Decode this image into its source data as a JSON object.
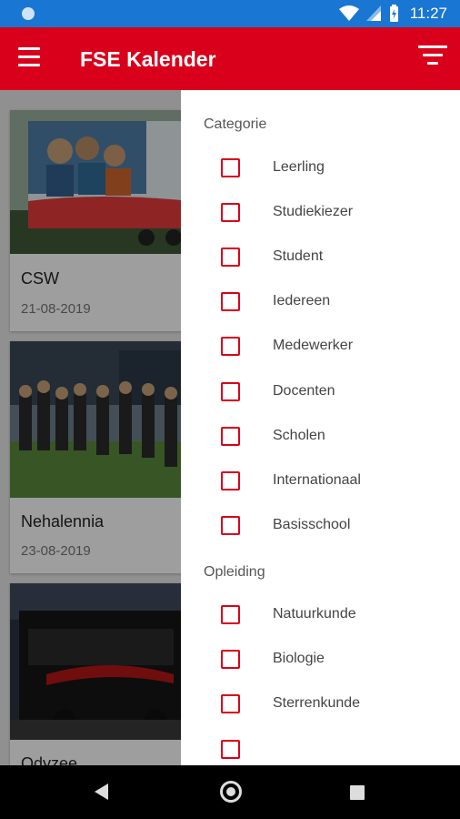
{
  "status_bar": {
    "time": "11:27",
    "icons": [
      "notification-dot-icon",
      "wifi-icon",
      "cellular-signal-icon",
      "battery-charging-icon"
    ]
  },
  "app_bar": {
    "title": "FSE Kalender",
    "menu_icon": "hamburger-menu-icon",
    "filter_icon": "filter-icon"
  },
  "events": [
    {
      "title": "CSW",
      "date": "21-08-2019"
    },
    {
      "title": "Nehalennia",
      "date": "23-08-2019"
    },
    {
      "title": "Odyzee",
      "date": ""
    }
  ],
  "drawer": {
    "sections": [
      {
        "header": "Categorie",
        "options": [
          {
            "label": "Leerling",
            "checked": false
          },
          {
            "label": "Studiekiezer",
            "checked": false
          },
          {
            "label": "Student",
            "checked": false
          },
          {
            "label": "Iedereen",
            "checked": false
          },
          {
            "label": "Medewerker",
            "checked": false
          },
          {
            "label": "Docenten",
            "checked": false
          },
          {
            "label": "Scholen",
            "checked": false
          },
          {
            "label": "Internationaal",
            "checked": false
          },
          {
            "label": "Basisschool",
            "checked": false
          }
        ]
      },
      {
        "header": "Opleiding",
        "options": [
          {
            "label": "Natuurkunde",
            "checked": false
          },
          {
            "label": "Biologie",
            "checked": false
          },
          {
            "label": "Sterrenkunde",
            "checked": false
          }
        ]
      }
    ]
  },
  "colors": {
    "status_bar": "#1976d2",
    "app_bar": "#d9001b",
    "checkbox_border": "#d9001b"
  },
  "nav_bar": {
    "buttons": [
      "back-icon",
      "home-icon",
      "recents-icon"
    ]
  }
}
